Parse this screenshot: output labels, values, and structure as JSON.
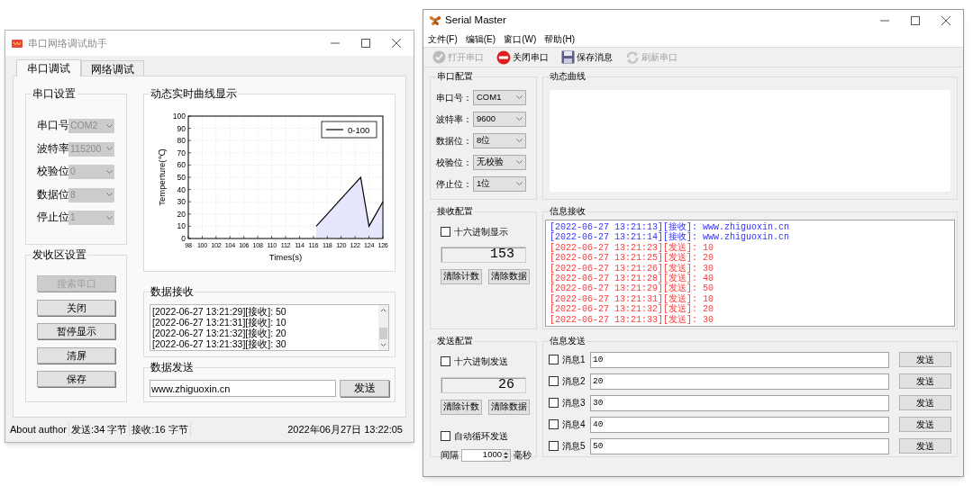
{
  "left_window": {
    "title": "串口网络调试助手",
    "tabs": [
      {
        "label": "串口调试",
        "selected": true
      },
      {
        "label": "网络调试",
        "selected": false
      }
    ],
    "serial_settings": {
      "title": "串口设置",
      "fields": [
        {
          "label": "串口号",
          "value": "COM2",
          "disabled": true
        },
        {
          "label": "波特率",
          "value": "115200",
          "disabled": true
        },
        {
          "label": "校验位",
          "value": "0",
          "disabled": true
        },
        {
          "label": "数据位",
          "value": "8",
          "disabled": true
        },
        {
          "label": "停止位",
          "value": "1",
          "disabled": true
        }
      ]
    },
    "buffer_settings": {
      "title": "发收区设置",
      "buttons": [
        {
          "label": "搜索串口",
          "disabled": true
        },
        {
          "label": "关闭",
          "disabled": false
        },
        {
          "label": "暂停显示",
          "disabled": false
        },
        {
          "label": "清屏",
          "disabled": false
        },
        {
          "label": "保存",
          "disabled": false
        }
      ]
    },
    "chart_panel": {
      "title": "动态实时曲线显示",
      "chart_data": {
        "type": "area",
        "xlabel": "Times(s)",
        "ylabel": "Temperture(℃)",
        "x": [
          116.4,
          118,
          119.6,
          121.2,
          122.8,
          124,
          126
        ],
        "series": [
          {
            "name": "0-100",
            "color": "#000000",
            "values": [
              10,
              20,
              30,
              40,
              50,
              10,
              30
            ]
          }
        ],
        "xlim": [
          98,
          126
        ],
        "ylim": [
          0,
          100
        ],
        "xticks": [
          98,
          100,
          102,
          104,
          106,
          108,
          110,
          112,
          114,
          116,
          118,
          120,
          122,
          124,
          126
        ],
        "yticks": [
          0,
          10,
          20,
          30,
          40,
          50,
          60,
          70,
          80,
          90,
          100
        ],
        "grid": true
      }
    },
    "receive": {
      "title": "数据接收",
      "lines": [
        "[2022-06-27 13:21:29][接收]: 50",
        "[2022-06-27 13:21:31][接收]: 10",
        "[2022-06-27 13:21:32][接收]: 20",
        "[2022-06-27 13:21:33][接收]: 30"
      ]
    },
    "send": {
      "title": "数据发送",
      "value": "www.zhiguoxin.cn",
      "button": "发送"
    },
    "status_bar": [
      "About author",
      "发送:34 字节",
      "接收:16 字节",
      "2022年06月27日 13:22:05"
    ]
  },
  "right_window": {
    "title": "Serial Master",
    "menu": [
      "文件(F)",
      "编辑(E)",
      "窗口(W)",
      "帮助(H)"
    ],
    "toolbar": [
      {
        "kind": "open",
        "label": "打开串口",
        "disabled": true
      },
      {
        "kind": "close",
        "label": "关闭串口",
        "disabled": false
      },
      {
        "kind": "save",
        "label": "保存消息",
        "disabled": false
      },
      {
        "kind": "refresh",
        "label": "刷新串口",
        "disabled": true
      }
    ],
    "port_config": {
      "title": "串口配置",
      "fields": [
        {
          "label": "串口号：",
          "value": "COM1"
        },
        {
          "label": "波特率：",
          "value": "9600"
        },
        {
          "label": "数据位：",
          "value": "8位"
        },
        {
          "label": "校验位：",
          "value": "无校验"
        },
        {
          "label": "停止位：",
          "value": "1位"
        }
      ]
    },
    "curve_panel": {
      "title": "动态曲线"
    },
    "receive_config": {
      "title": "接收配置",
      "hex_display": {
        "label": "十六进制显示",
        "checked": false
      },
      "counter": "153",
      "buttons": [
        "清除计数",
        "清除数据"
      ]
    },
    "receive_log": {
      "title": "信息接收",
      "lines": [
        {
          "kind": "received",
          "text": "[2022-06-27 13:21:13][接收]: www.zhiguoxin.cn"
        },
        {
          "kind": "received",
          "text": "[2022-06-27 13:21:14][接收]: www.zhiguoxin.cn"
        },
        {
          "kind": "sent",
          "text": "[2022-06-27 13:21:23][发送]: 10"
        },
        {
          "kind": "sent",
          "text": "[2022-06-27 13:21:25][发送]: 20"
        },
        {
          "kind": "sent",
          "text": "[2022-06-27 13:21:26][发送]: 30"
        },
        {
          "kind": "sent",
          "text": "[2022-06-27 13:21:28][发送]: 40"
        },
        {
          "kind": "sent",
          "text": "[2022-06-27 13:21:29][发送]: 50"
        },
        {
          "kind": "sent",
          "text": "[2022-06-27 13:21:31][发送]: 10"
        },
        {
          "kind": "sent",
          "text": "[2022-06-27 13:21:32][发送]: 20"
        },
        {
          "kind": "sent",
          "text": "[2022-06-27 13:21:33][发送]: 30"
        }
      ]
    },
    "send_config": {
      "title": "发送配置",
      "hex_send": {
        "label": "十六进制发送",
        "checked": false
      },
      "counter": "26",
      "buttons": [
        "清除计数",
        "清除数据"
      ],
      "auto_loop": {
        "label": "自动循环发送",
        "checked": false
      },
      "interval": {
        "label": "间隔",
        "value": "1000",
        "unit": "毫秒"
      }
    },
    "send_messages": {
      "title": "信息发送",
      "rows": [
        {
          "label": "消息1",
          "checked": false,
          "value": "10",
          "button": "发送"
        },
        {
          "label": "消息2",
          "checked": false,
          "value": "20",
          "button": "发送"
        },
        {
          "label": "消息3",
          "checked": false,
          "value": "30",
          "button": "发送"
        },
        {
          "label": "消息4",
          "checked": false,
          "value": "40",
          "button": "发送"
        },
        {
          "label": "消息5",
          "checked": false,
          "value": "50",
          "button": "发送"
        }
      ]
    }
  }
}
